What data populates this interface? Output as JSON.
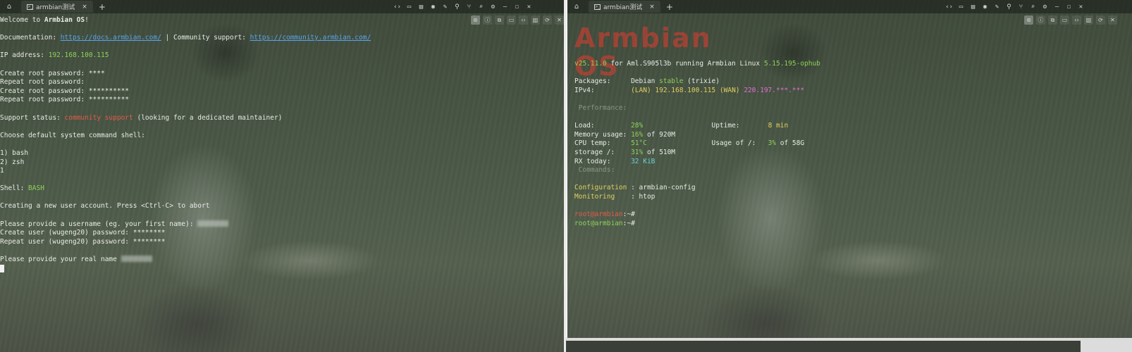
{
  "left": {
    "tab_title": "armbian测试",
    "lines": [
      [
        {
          "t": "Welcome to "
        },
        {
          "t": "Armbian OS",
          "c": "b"
        },
        {
          "t": "!"
        }
      ],
      [],
      [
        {
          "t": "Documentation: "
        },
        {
          "t": "https://docs.armbian.com/",
          "c": "link"
        },
        {
          "t": " | Community support: "
        },
        {
          "t": "https://community.armbian.com/",
          "c": "link"
        }
      ],
      [],
      [
        {
          "t": "IP address: "
        },
        {
          "t": "192.168.100.115",
          "c": "grn"
        }
      ],
      [],
      [
        {
          "t": "Create root password: ****"
        }
      ],
      [
        {
          "t": "Repeat root password:"
        }
      ],
      [
        {
          "t": "Create root password: **********"
        }
      ],
      [
        {
          "t": "Repeat root password: **********"
        }
      ],
      [],
      [
        {
          "t": "Support status: "
        },
        {
          "t": "community support",
          "c": "red"
        },
        {
          "t": " (looking for a dedicated maintainer)"
        }
      ],
      [],
      [
        {
          "t": "Choose default system command shell:"
        }
      ],
      [],
      [
        {
          "t": "1) bash"
        }
      ],
      [
        {
          "t": "2) zsh"
        }
      ],
      [
        {
          "t": "1"
        }
      ],
      [],
      [
        {
          "t": "Shell: "
        },
        {
          "t": "BASH",
          "c": "grn"
        }
      ],
      [],
      [
        {
          "t": "Creating a new user account. Press <Ctrl-C> to abort"
        }
      ],
      [],
      [
        {
          "t": "Please provide a username (eg. your first name): "
        },
        {
          "blur": true
        }
      ],
      [
        {
          "t": "Create user (wugeng20) password: ********"
        }
      ],
      [
        {
          "t": "Repeat user (wugeng20) password: ********"
        }
      ],
      [],
      [
        {
          "t": "Please provide your real name "
        },
        {
          "blur": true
        }
      ],
      [
        {
          "cursor": true
        }
      ]
    ]
  },
  "right": {
    "tab_title": "armbian测试",
    "banner": "Armbian OS",
    "lines": [
      [
        {
          "t": "v25.11.0",
          "c": "grn"
        },
        {
          "t": " for Aml.S905l3b running Armbian Linux "
        },
        {
          "t": "5.15.195-ophub",
          "c": "grn"
        }
      ],
      [],
      [
        {
          "t": "Packages:     Debian "
        },
        {
          "t": "stable",
          "c": "grn"
        },
        {
          "t": " (trixie)"
        }
      ],
      [
        {
          "t": "IPv4:         "
        },
        {
          "t": "(LAN) 192.168.100.115 (WAN) ",
          "c": "yel"
        },
        {
          "t": "220.197.***.***",
          "c": "mag"
        }
      ],
      [],
      [
        {
          "t": " Performance:",
          "c": "dim"
        }
      ],
      [],
      [
        {
          "t": "Load:         "
        },
        {
          "t": "28%",
          "c": "grn"
        },
        {
          "t": "                 Uptime:       "
        },
        {
          "t": "8 min",
          "c": "yel"
        }
      ],
      [
        {
          "t": "Memory usage: "
        },
        {
          "t": "16%",
          "c": "grn"
        },
        {
          "t": " of 920M"
        }
      ],
      [
        {
          "t": "CPU temp:     "
        },
        {
          "t": "51°C",
          "c": "grn"
        },
        {
          "t": "                Usage of /:   "
        },
        {
          "t": "3%",
          "c": "grn"
        },
        {
          "t": " of 58G"
        }
      ],
      [
        {
          "t": "storage /:    "
        },
        {
          "t": "31%",
          "c": "grn"
        },
        {
          "t": " of 510M"
        }
      ],
      [
        {
          "t": "RX today:     "
        },
        {
          "t": "32 KiB",
          "c": "cyan"
        }
      ],
      [
        {
          "t": " Commands:",
          "c": "dim"
        }
      ],
      [],
      [
        {
          "t": "Configuration",
          "c": "yel"
        },
        {
          "t": " : armbian-config"
        }
      ],
      [
        {
          "t": "Monitoring",
          "c": "yel"
        },
        {
          "t": "    : htop"
        }
      ],
      [],
      [
        {
          "t": "root@armbian",
          "c": "red"
        },
        {
          "t": ":~#"
        }
      ],
      [
        {
          "t": "root@armbian",
          "c": "grn"
        },
        {
          "t": ":~#"
        }
      ]
    ]
  },
  "toolbar_icons": [
    "code-icon",
    "folder-icon",
    "file-icon",
    "record-icon",
    "pen-icon",
    "pin-icon",
    "fork-icon",
    "search-icon",
    "gear-icon",
    "minimize-icon",
    "maximize-icon",
    "close-icon"
  ],
  "toolbar_glyphs": [
    "‹›",
    "▭",
    "▤",
    "◉",
    "✎",
    "⚲",
    "⑂",
    "⌕",
    "⚙",
    "—",
    "☐",
    "✕"
  ],
  "subtool_icons": [
    "pin-icon",
    "info-icon",
    "copy-icon",
    "folder-icon",
    "code-icon",
    "terminal-icon",
    "refresh-icon",
    "close-icon"
  ],
  "subtool_glyphs": [
    "⊛",
    "ⓘ",
    "⧉",
    "▭",
    "‹›",
    "▥",
    "⟳",
    "✕"
  ]
}
